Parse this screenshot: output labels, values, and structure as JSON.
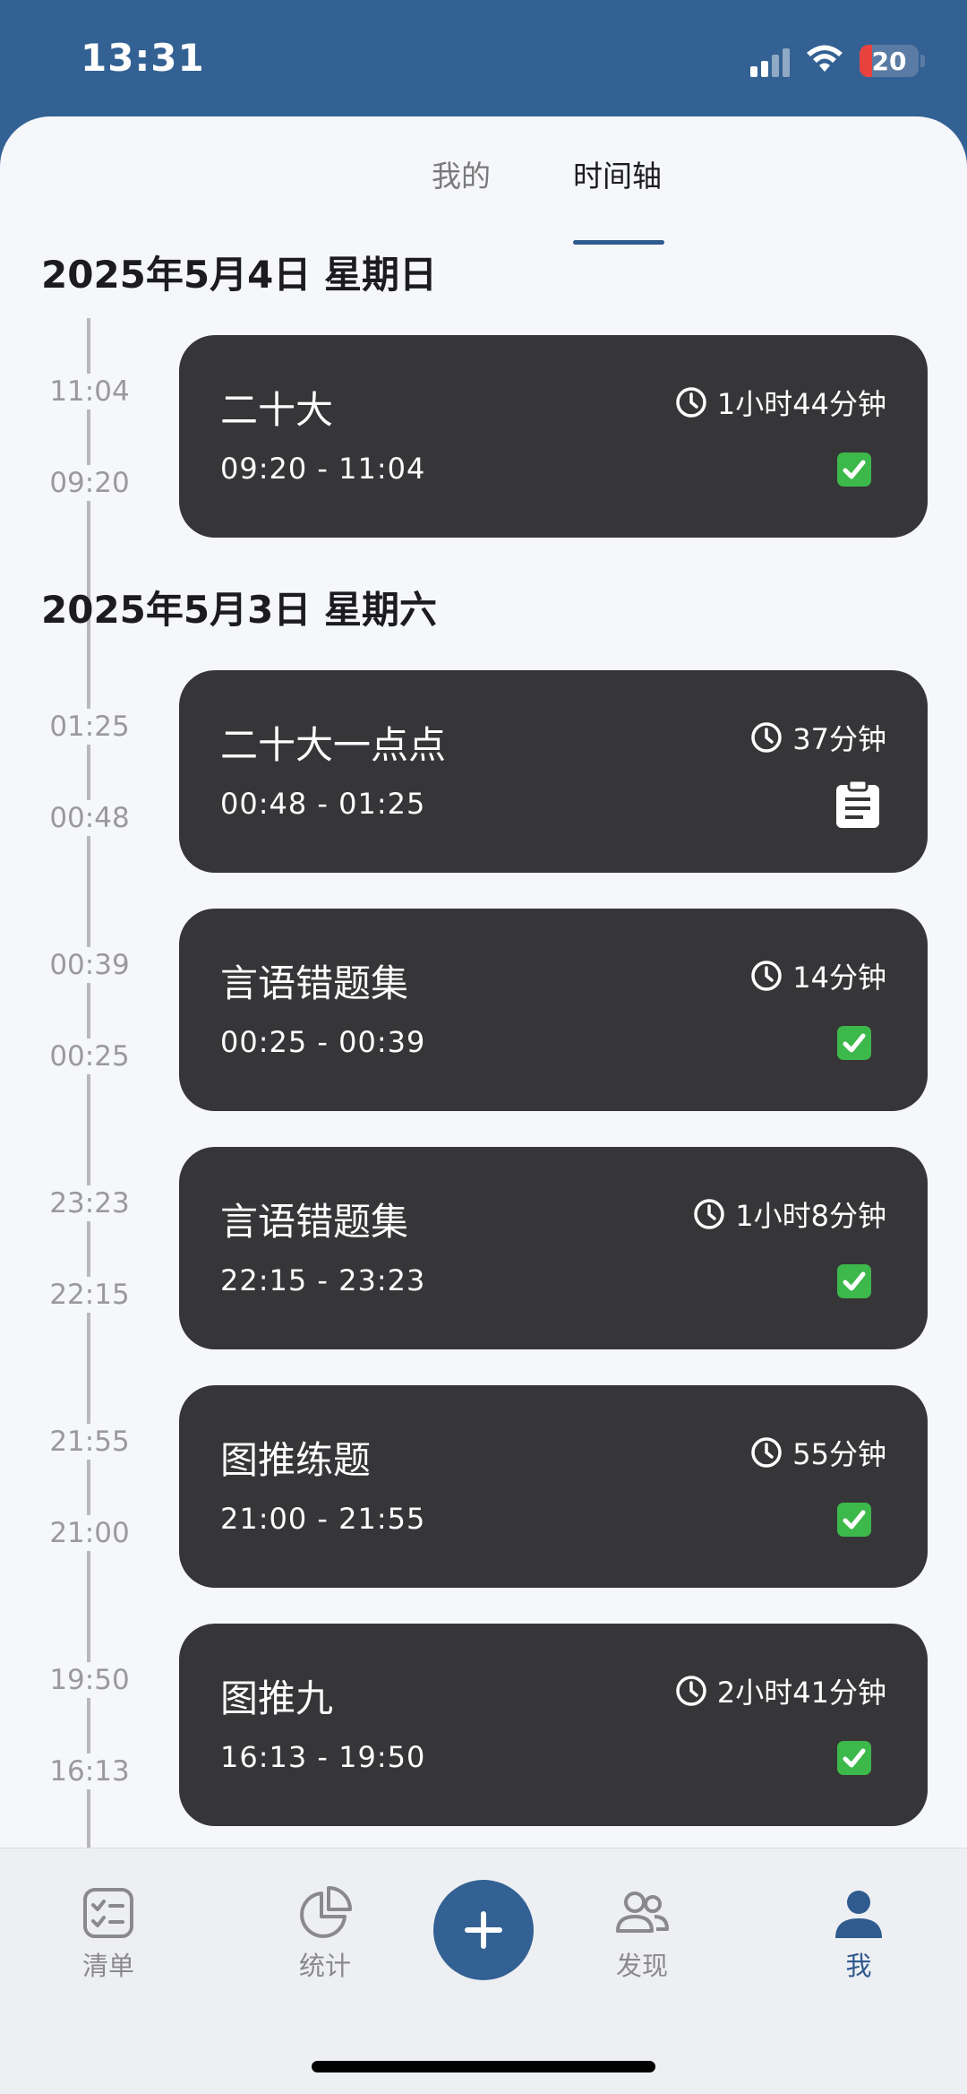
{
  "status_bar": {
    "time": "13:31",
    "battery": "20"
  },
  "tabs": [
    {
      "label": "我的",
      "active": false
    },
    {
      "label": "时间轴",
      "active": true
    }
  ],
  "days": [
    {
      "date": "2025年5月4日 星期日",
      "entries": [
        {
          "title": "二十大",
          "duration": "1小时44分钟",
          "range": "09:20 - 11:04",
          "end_label": "11:04",
          "start_label": "09:20",
          "status_icon": "check-box-icon"
        }
      ]
    },
    {
      "date": "2025年5月3日 星期六",
      "entries": [
        {
          "title": "二十大一点点",
          "duration": "37分钟",
          "range": "00:48 - 01:25",
          "end_label": "01:25",
          "start_label": "00:48",
          "status_icon": "clipboard-icon"
        },
        {
          "title": "言语错题集",
          "duration": "14分钟",
          "range": "00:25 - 00:39",
          "end_label": "00:39",
          "start_label": "00:25",
          "status_icon": "check-box-icon"
        },
        {
          "title": "言语错题集",
          "duration": "1小时8分钟",
          "range": "22:15 - 23:23",
          "end_label": "23:23",
          "start_label": "22:15",
          "status_icon": "check-box-icon"
        },
        {
          "title": "图推练题",
          "duration": "55分钟",
          "range": "21:00 - 21:55",
          "end_label": "21:55",
          "start_label": "21:00",
          "status_icon": "check-box-icon"
        },
        {
          "title": "图推九",
          "duration": "2小时41分钟",
          "range": "16:13 - 19:50",
          "end_label": "19:50",
          "start_label": "16:13",
          "status_icon": "check-box-icon"
        }
      ]
    }
  ],
  "bottom_nav": [
    {
      "label": "清单",
      "icon": "checklist-icon",
      "active": false
    },
    {
      "label": "统计",
      "icon": "pie-chart-icon",
      "active": false
    },
    {
      "label": "发现",
      "icon": "people-icon",
      "active": false
    },
    {
      "label": "我",
      "icon": "person-icon",
      "active": true
    }
  ],
  "fab": {
    "icon": "plus-icon"
  },
  "colors": {
    "accent": "#336193",
    "card": "#363638",
    "check_green": "#3db84a"
  }
}
